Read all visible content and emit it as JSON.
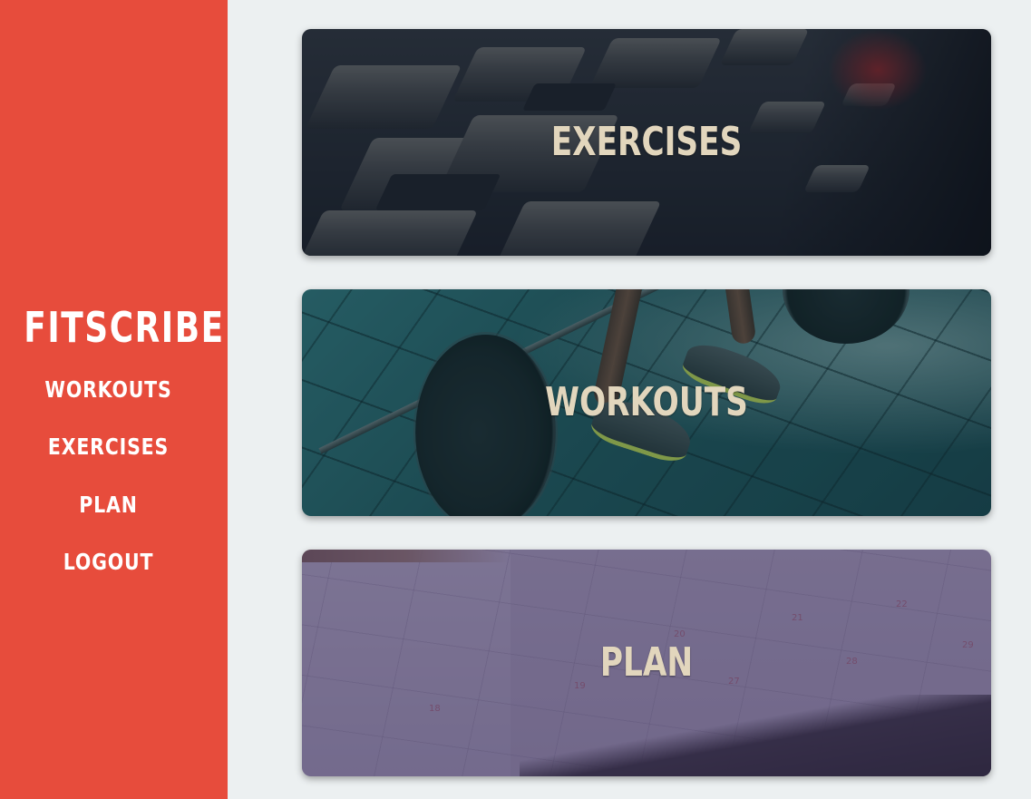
{
  "sidebar": {
    "brand": "FITSCRIBE",
    "nav": [
      {
        "label": "WORKOUTS"
      },
      {
        "label": "EXERCISES"
      },
      {
        "label": "PLAN"
      },
      {
        "label": "LOGOUT"
      }
    ],
    "background_color": "#e74c3c"
  },
  "main": {
    "background_color": "#ecf0f1",
    "cards": [
      {
        "title": "EXERCISES",
        "image": "dumbbell-rack-photo"
      },
      {
        "title": "WORKOUTS",
        "image": "barbell-deadlift-photo"
      },
      {
        "title": "PLAN",
        "image": "calendar-notebook-photo"
      }
    ],
    "card_title_color": "#e2d6bd"
  },
  "plan_calendar_numbers": [
    "29",
    "21",
    "22",
    "28",
    "27",
    "20",
    "18",
    "19"
  ]
}
